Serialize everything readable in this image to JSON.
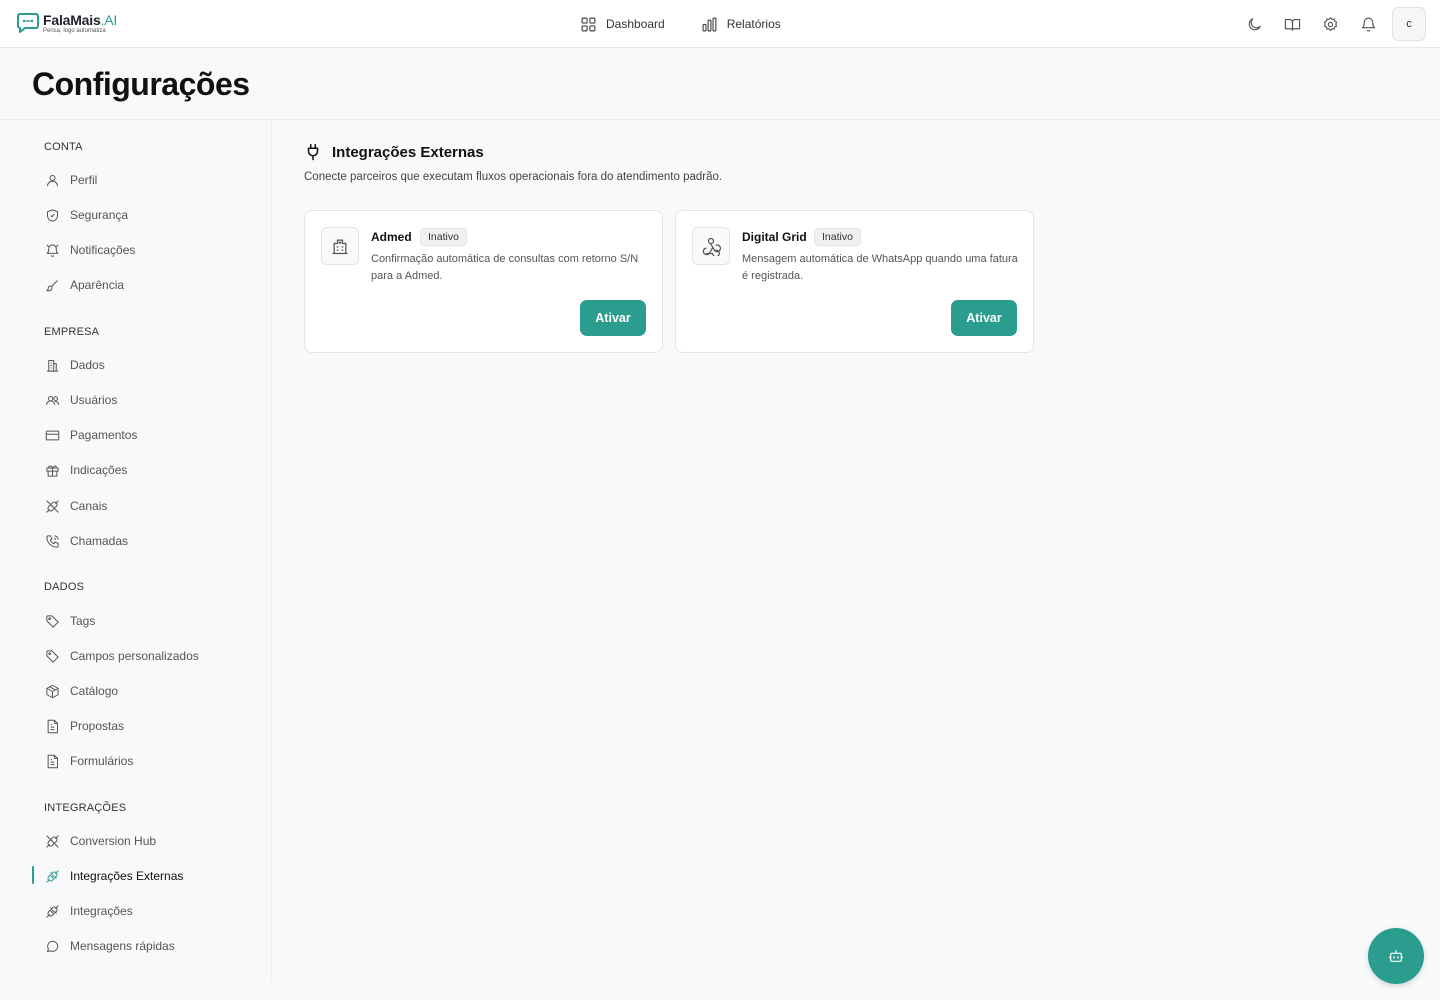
{
  "brand": {
    "name": "FalaMais",
    "suffix": ".AI",
    "tagline": "Pensa, logo automatiza",
    "accent": "#2a9d8f"
  },
  "topnav": [
    {
      "label": "Dashboard",
      "icon": "grid-icon"
    },
    {
      "label": "Relatórios",
      "icon": "bar-chart-icon"
    }
  ],
  "topicons": [
    "moon-icon",
    "book-icon",
    "gear-icon",
    "bell-icon"
  ],
  "user": {
    "initial": "c"
  },
  "page": {
    "title": "Configurações"
  },
  "sidebar": {
    "sections": [
      {
        "title": "CONTA",
        "items": [
          {
            "label": "Perfil",
            "icon": "user-icon"
          },
          {
            "label": "Segurança",
            "icon": "shield-icon"
          },
          {
            "label": "Notificações",
            "icon": "bell-off-icon"
          },
          {
            "label": "Aparência",
            "icon": "brush-icon"
          }
        ]
      },
      {
        "title": "EMPRESA",
        "items": [
          {
            "label": "Dados",
            "icon": "building-icon"
          },
          {
            "label": "Usuários",
            "icon": "users-icon"
          },
          {
            "label": "Pagamentos",
            "icon": "credit-card-icon"
          },
          {
            "label": "Indicações",
            "icon": "gift-icon"
          },
          {
            "label": "Canais",
            "icon": "plug-off-icon"
          },
          {
            "label": "Chamadas",
            "icon": "phone-icon"
          }
        ]
      },
      {
        "title": "DADOS",
        "items": [
          {
            "label": "Tags",
            "icon": "tag-icon"
          },
          {
            "label": "Campos personalizados",
            "icon": "tag-icon"
          },
          {
            "label": "Catálogo",
            "icon": "package-icon"
          },
          {
            "label": "Propostas",
            "icon": "file-text-icon"
          },
          {
            "label": "Formulários",
            "icon": "file-text-icon"
          }
        ]
      },
      {
        "title": "INTEGRAÇÕES",
        "items": [
          {
            "label": "Conversion Hub",
            "icon": "plug-off-icon"
          },
          {
            "label": "Integrações Externas",
            "icon": "plug-icon",
            "active": true
          },
          {
            "label": "Integrações",
            "icon": "plug-icon"
          },
          {
            "label": "Mensagens rápidas",
            "icon": "message-circle-icon"
          }
        ]
      }
    ]
  },
  "main": {
    "title": "Integrações Externas",
    "description": "Conecte parceiros que executam fluxos operacionais fora do atendimento padrão.",
    "cards": [
      {
        "name": "Admed",
        "status": "Inativo",
        "description": "Confirmação automática de consultas com retorno S/N para a Admed.",
        "button": "Ativar",
        "icon": "hospital-icon"
      },
      {
        "name": "Digital Grid",
        "status": "Inativo",
        "description": "Mensagem automática de WhatsApp quando uma fatura é registrada.",
        "button": "Ativar",
        "icon": "webhook-icon"
      }
    ]
  },
  "fab": {
    "icon": "bot-icon"
  }
}
